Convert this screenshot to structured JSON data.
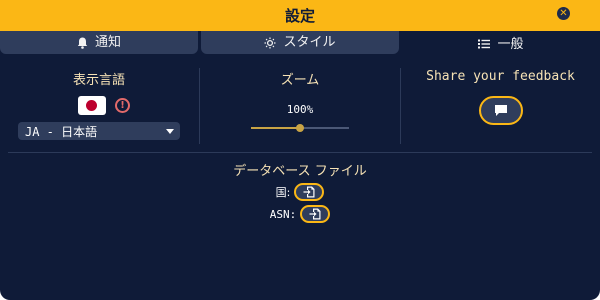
{
  "window": {
    "title": "設定",
    "close_icon": "close-icon"
  },
  "tabs": [
    {
      "label": "通知",
      "icon": "bell-icon",
      "active": false
    },
    {
      "label": "スタイル",
      "icon": "sun-icon",
      "active": false
    },
    {
      "label": "一般",
      "icon": "list-icon",
      "active": true
    }
  ],
  "language": {
    "heading": "表示言語",
    "flag": "japan-flag",
    "warning_icon": "warning-icon",
    "selected": "JA - 日本語"
  },
  "zoom": {
    "heading": "ズーム",
    "value_label": "100%",
    "slider_fraction": 0.5
  },
  "feedback": {
    "heading": "Share your feedback",
    "icon": "comment-icon"
  },
  "database": {
    "heading": "データベース ファイル",
    "country_label": "国:",
    "asn_label": "ASN:",
    "import_icon": "file-import-icon"
  },
  "colors": {
    "accent": "#fbb715",
    "background": "#0f1b38",
    "surface": "#2f3d5c",
    "heading_text": "#f6e2b5",
    "warning": "#e26a6a"
  }
}
